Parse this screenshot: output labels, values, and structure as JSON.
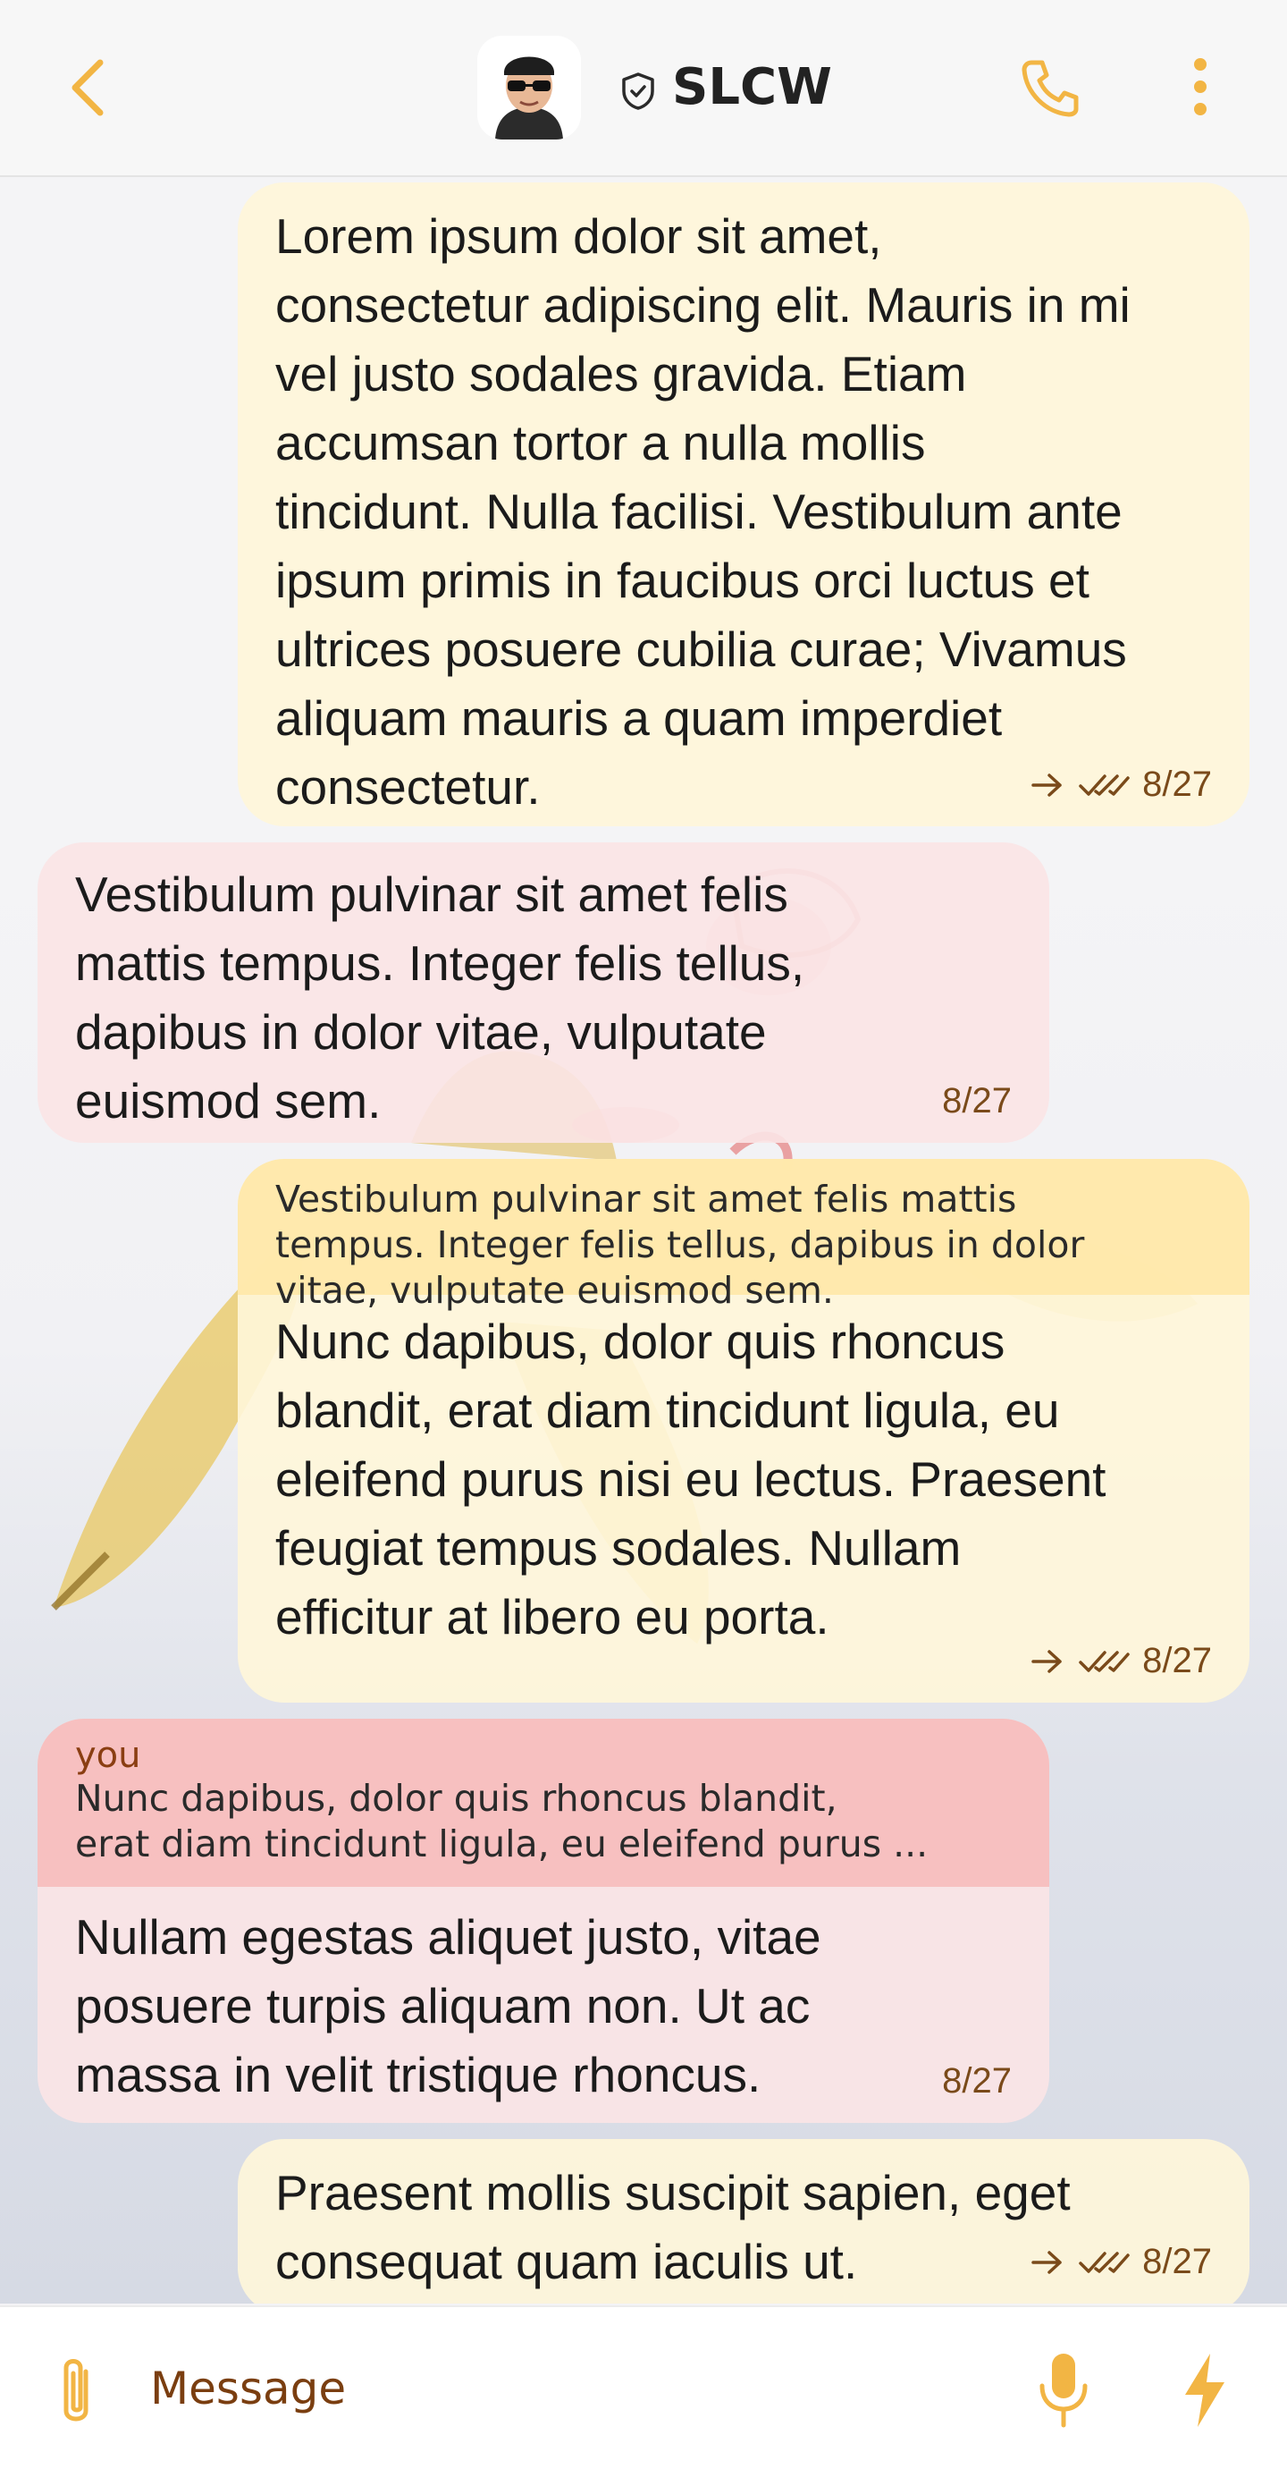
{
  "header": {
    "title": "SLCW",
    "icons": [
      "chevron-left-icon",
      "avatar",
      "shield-icon",
      "phone-icon",
      "more-vertical-icon"
    ]
  },
  "colors": {
    "accent": "#f2b544",
    "outgoing_bubble": "#fff6d9",
    "incoming_bubble": "#fbe4e6",
    "quote_outgoing": "#ffe8aa",
    "quote_incoming": "#f7bebe",
    "meta_text": "#7a4a1a"
  },
  "messages": [
    {
      "direction": "outgoing",
      "text": "Lorem ipsum dolor sit amet,\nconsectetur adipiscing elit. Mauris in mi\nvel justo sodales gravida. Etiam\naccumsan tortor a nulla mollis\ntincidunt. Nulla facilisi. Vestibulum ante\nipsum primis in faucibus orci luctus et\nultrices posuere cubilia curae; Vivamus\naliquam mauris a quam imperdiet\nconsectetur.",
      "time": "8/27",
      "status": "read"
    },
    {
      "direction": "incoming",
      "text": "Vestibulum pulvinar sit amet felis\nmattis tempus. Integer felis tellus,\ndapibus in dolor vitae, vulputate\neuismod sem.",
      "time": "8/27"
    },
    {
      "direction": "outgoing",
      "quote": "Vestibulum pulvinar sit amet felis mattis\ntempus. Integer felis tellus, dapibus in dolor\nvitae, vulputate euismod sem.",
      "text": "Nunc dapibus, dolor quis rhoncus\nblandit, erat diam tincidunt ligula, eu\neleifend purus nisi eu lectus. Praesent\nfeugiat tempus sodales. Nullam\nefficitur at libero eu porta.",
      "time": "8/27",
      "status": "read"
    },
    {
      "direction": "incoming",
      "quote_author": "you",
      "quote_line1": "Nunc dapibus, dolor quis rhoncus blandit,",
      "quote_line2": "erat diam tincidunt ligula, eu eleifend purus ...",
      "text": "Nullam egestas aliquet justo, vitae\nposuere turpis aliquam non. Ut ac\nmassa in velit tristique rhoncus.",
      "time": "8/27"
    },
    {
      "direction": "outgoing",
      "text": "Praesent mollis suscipit sapien, eget\nconsequat quam iaculis ut.",
      "time": "8/27",
      "status": "read"
    }
  ],
  "composer": {
    "placeholder": "Message",
    "icons": [
      "paperclip-icon",
      "microphone-icon",
      "lightning-icon"
    ]
  }
}
